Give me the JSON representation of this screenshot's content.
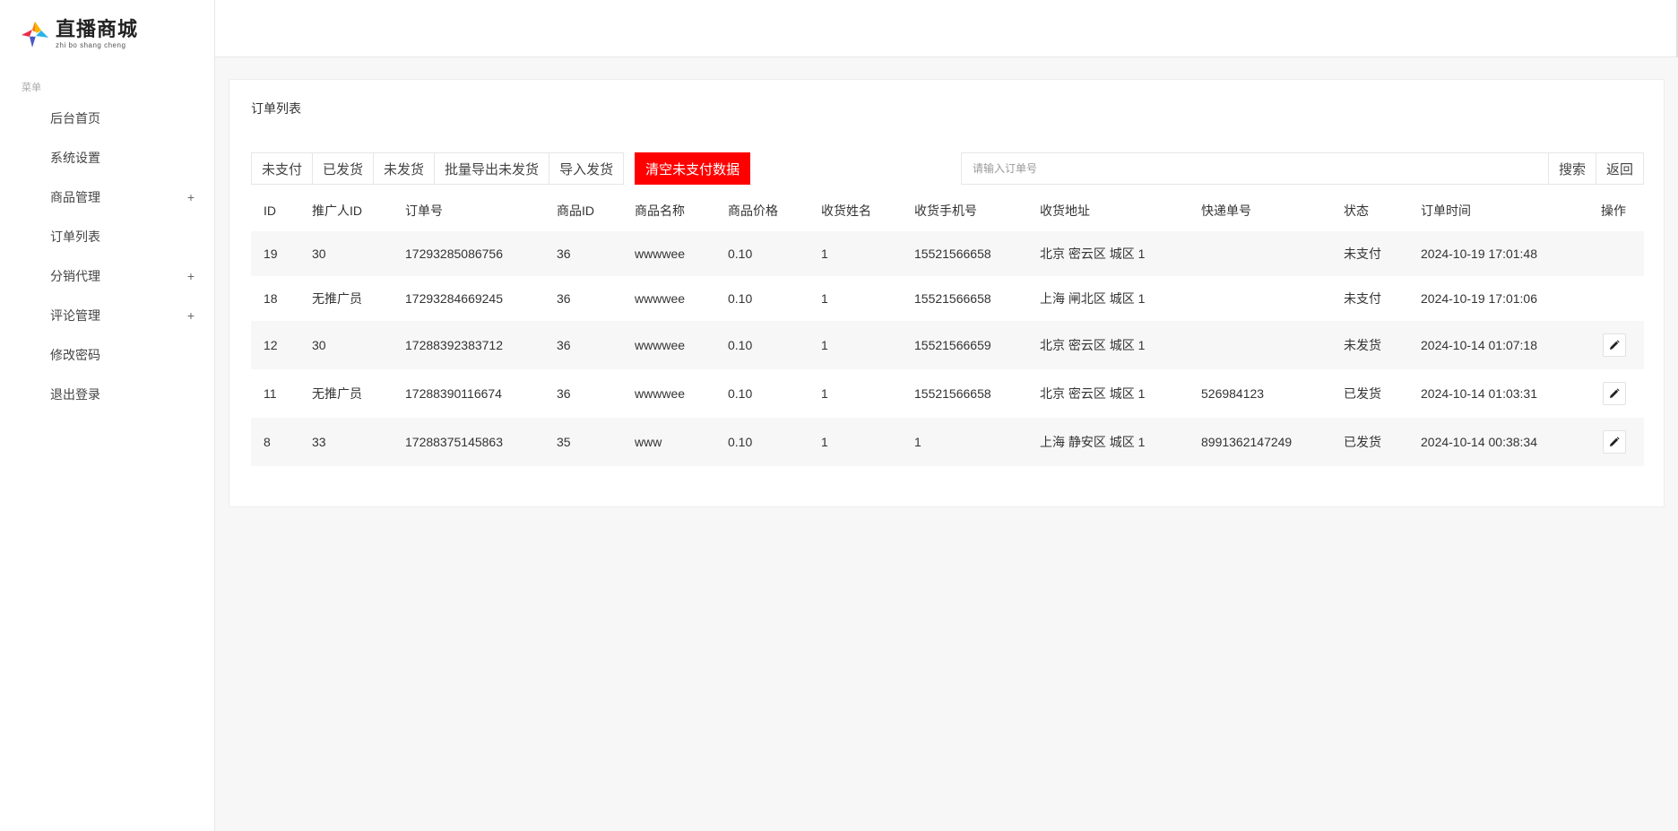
{
  "logo": {
    "name_cn": "直播商城",
    "name_en": "zhi bo shang cheng"
  },
  "sidebar": {
    "heading": "菜单",
    "items": [
      {
        "label": "后台首页",
        "expandable": false
      },
      {
        "label": "系统设置",
        "expandable": false
      },
      {
        "label": "商品管理",
        "expandable": true,
        "icon": "+"
      },
      {
        "label": "订单列表",
        "expandable": false
      },
      {
        "label": "分销代理",
        "expandable": true,
        "icon": "+"
      },
      {
        "label": "评论管理",
        "expandable": true,
        "icon": "+"
      },
      {
        "label": "修改密码",
        "expandable": false
      },
      {
        "label": "退出登录",
        "expandable": false
      }
    ]
  },
  "card": {
    "title": "订单列表"
  },
  "toolbar": {
    "unpaid": "未支付",
    "shipped": "已发货",
    "unshipped": "未发货",
    "export_unshipped": "批量导出未发货",
    "import_shipping": "导入发货",
    "clear_unpaid": "清空未支付数据"
  },
  "search": {
    "placeholder": "请输入订单号",
    "value": "",
    "search_label": "搜索",
    "back_label": "返回"
  },
  "table": {
    "columns": [
      "ID",
      "推广人ID",
      "订单号",
      "商品ID",
      "商品名称",
      "商品价格",
      "收货姓名",
      "收货手机号",
      "收货地址",
      "快递单号",
      "状态",
      "订单时间",
      "操作"
    ],
    "rows": [
      {
        "id": "19",
        "promoter": "30",
        "order_no": "17293285086756",
        "product_id": "36",
        "product_name": "wwwwee",
        "price": "0.10",
        "name": "1",
        "phone": "15521566658",
        "address": "北京 密云区 城区 1",
        "tracking": "",
        "status": "未支付",
        "time": "2024-10-19 17:01:48"
      },
      {
        "id": "18",
        "promoter": "无推广员",
        "order_no": "17293284669245",
        "product_id": "36",
        "product_name": "wwwwee",
        "price": "0.10",
        "name": "1",
        "phone": "15521566658",
        "address": "上海 闸北区 城区 1",
        "tracking": "",
        "status": "未支付",
        "time": "2024-10-19 17:01:06"
      },
      {
        "id": "12",
        "promoter": "30",
        "order_no": "17288392383712",
        "product_id": "36",
        "product_name": "wwwwee",
        "price": "0.10",
        "name": "1",
        "phone": "15521566659",
        "address": "北京 密云区 城区 1",
        "tracking": "",
        "status": "未发货",
        "time": "2024-10-14 01:07:18"
      },
      {
        "id": "11",
        "promoter": "无推广员",
        "order_no": "17288390116674",
        "product_id": "36",
        "product_name": "wwwwee",
        "price": "0.10",
        "name": "1",
        "phone": "15521566658",
        "address": "北京 密云区 城区 1",
        "tracking": "526984123",
        "status": "已发货",
        "time": "2024-10-14 01:03:31"
      },
      {
        "id": "8",
        "promoter": "33",
        "order_no": "17288375145863",
        "product_id": "35",
        "product_name": "www",
        "price": "0.10",
        "name": "1",
        "phone": "1",
        "address": "上海 静安区 城区 1",
        "tracking": "8991362147249",
        "status": "已发货",
        "time": "2024-10-14 00:38:34"
      }
    ]
  },
  "colors": {
    "danger_button": "#ff0000",
    "status_unshipped": "#ff5722",
    "status_shipped": "#009688",
    "promoter_highlight": "#e60012"
  },
  "icons": {
    "edit": "pencil-icon",
    "expand": "plus-icon"
  }
}
